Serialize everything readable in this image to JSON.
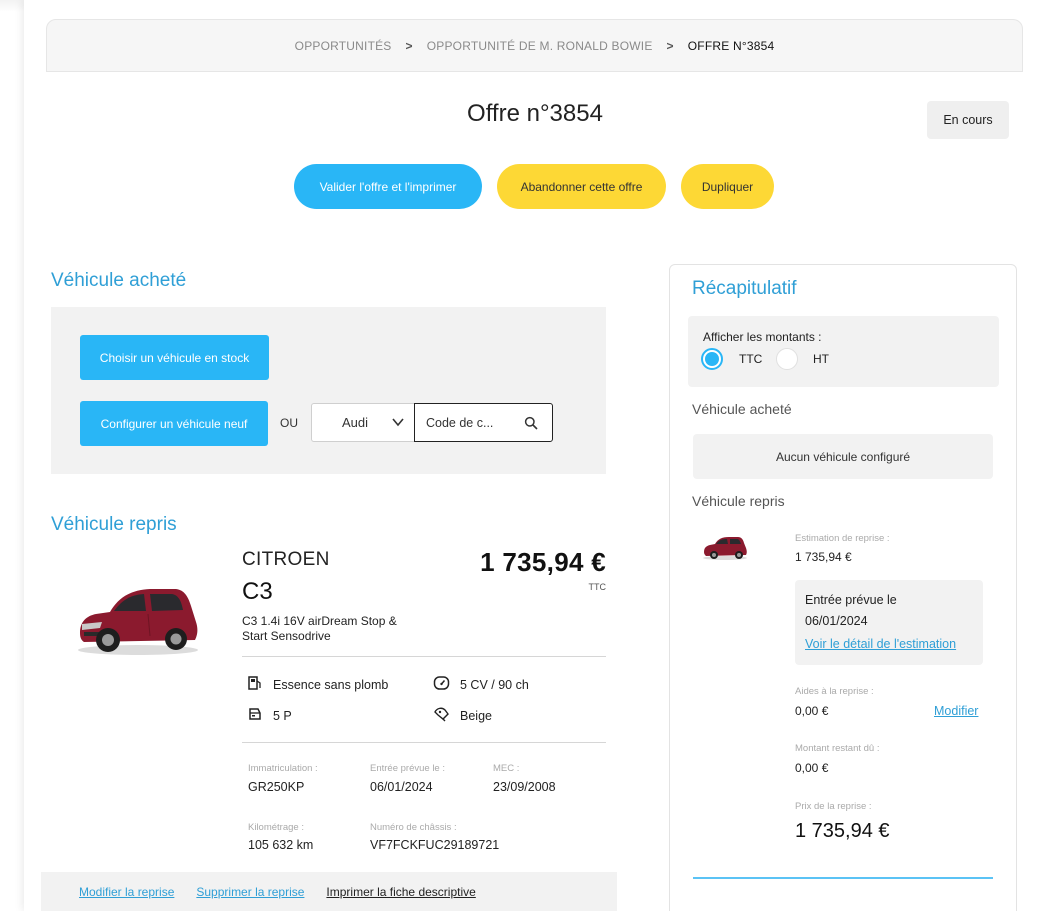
{
  "breadcrumb": {
    "items": [
      "OPPORTUNITÉS",
      "OPPORTUNITÉ DE M. RONALD BOWIE",
      "OFFRE N°3854"
    ],
    "separator": ">"
  },
  "header": {
    "title": "Offre n°3854",
    "status": "En cours"
  },
  "actions": {
    "validate": "Valider l'offre et l'imprimer",
    "abandon": "Abandonner cette offre",
    "duplicate": "Dupliquer"
  },
  "vehicle_bought": {
    "title": "Véhicule acheté",
    "choose_stock": "Choisir un véhicule en stock",
    "configure_new": "Configurer un véhicule neuf",
    "or_label": "OU",
    "brand": "Audi",
    "code_placeholder": "Code de c..."
  },
  "vehicle_taken": {
    "title": "Véhicule repris",
    "make": "CITROEN",
    "model": "C3",
    "version": "C3 1.4i 16V airDream Stop & Start Sensodrive",
    "price": "1 735,94 €",
    "price_tax": "TTC",
    "specs": {
      "fuel": "Essence sans plomb",
      "power": "5 CV / 90 ch",
      "doors": "5 P",
      "color": "Beige"
    },
    "details": {
      "registration_label": "Immatriculation :",
      "registration": "GR250KP",
      "entry_label": "Entrée prévue le :",
      "entry": "06/01/2024",
      "mec_label": "MEC :",
      "mec": "23/09/2008",
      "mileage_label": "Kilométrage :",
      "mileage": "105 632 km",
      "vin_label": "Numéro de châssis :",
      "vin": "VF7FCKFUC29189721"
    },
    "footer": {
      "edit": "Modifier la reprise",
      "delete": "Supprimer la reprise",
      "print": "Imprimer la fiche descriptive"
    }
  },
  "recap": {
    "title": "Récapitulatif",
    "amounts_label": "Afficher les montants :",
    "ttc": "TTC",
    "ht": "HT",
    "selected": "TTC",
    "bought_label": "Véhicule acheté",
    "no_vehicle": "Aucun véhicule configuré",
    "taken_label": "Véhicule repris",
    "estimation_label": "Estimation de reprise :",
    "estimation": "1 735,94 €",
    "entry_title": "Entrée prévue le",
    "entry_date": "06/01/2024",
    "estimation_link": "Voir le détail de l'estimation",
    "aids_label": "Aides à la reprise :",
    "aids": "0,00 €",
    "modify": "Modifier",
    "remaining_label": "Montant restant dû :",
    "remaining": "0,00 €",
    "price_label": "Prix de la reprise :",
    "price": "1 735,94 €"
  },
  "colors": {
    "accent_blue": "#29b6f6",
    "accent_yellow": "#fdd835",
    "heading_blue": "#2f9fd6",
    "car_red": "#8b1a2e"
  },
  "icons": [
    "chevron-down-icon",
    "search-icon",
    "fuel-pump-icon",
    "speedometer-icon",
    "car-doors-icon",
    "paint-icon",
    "car-photo"
  ]
}
